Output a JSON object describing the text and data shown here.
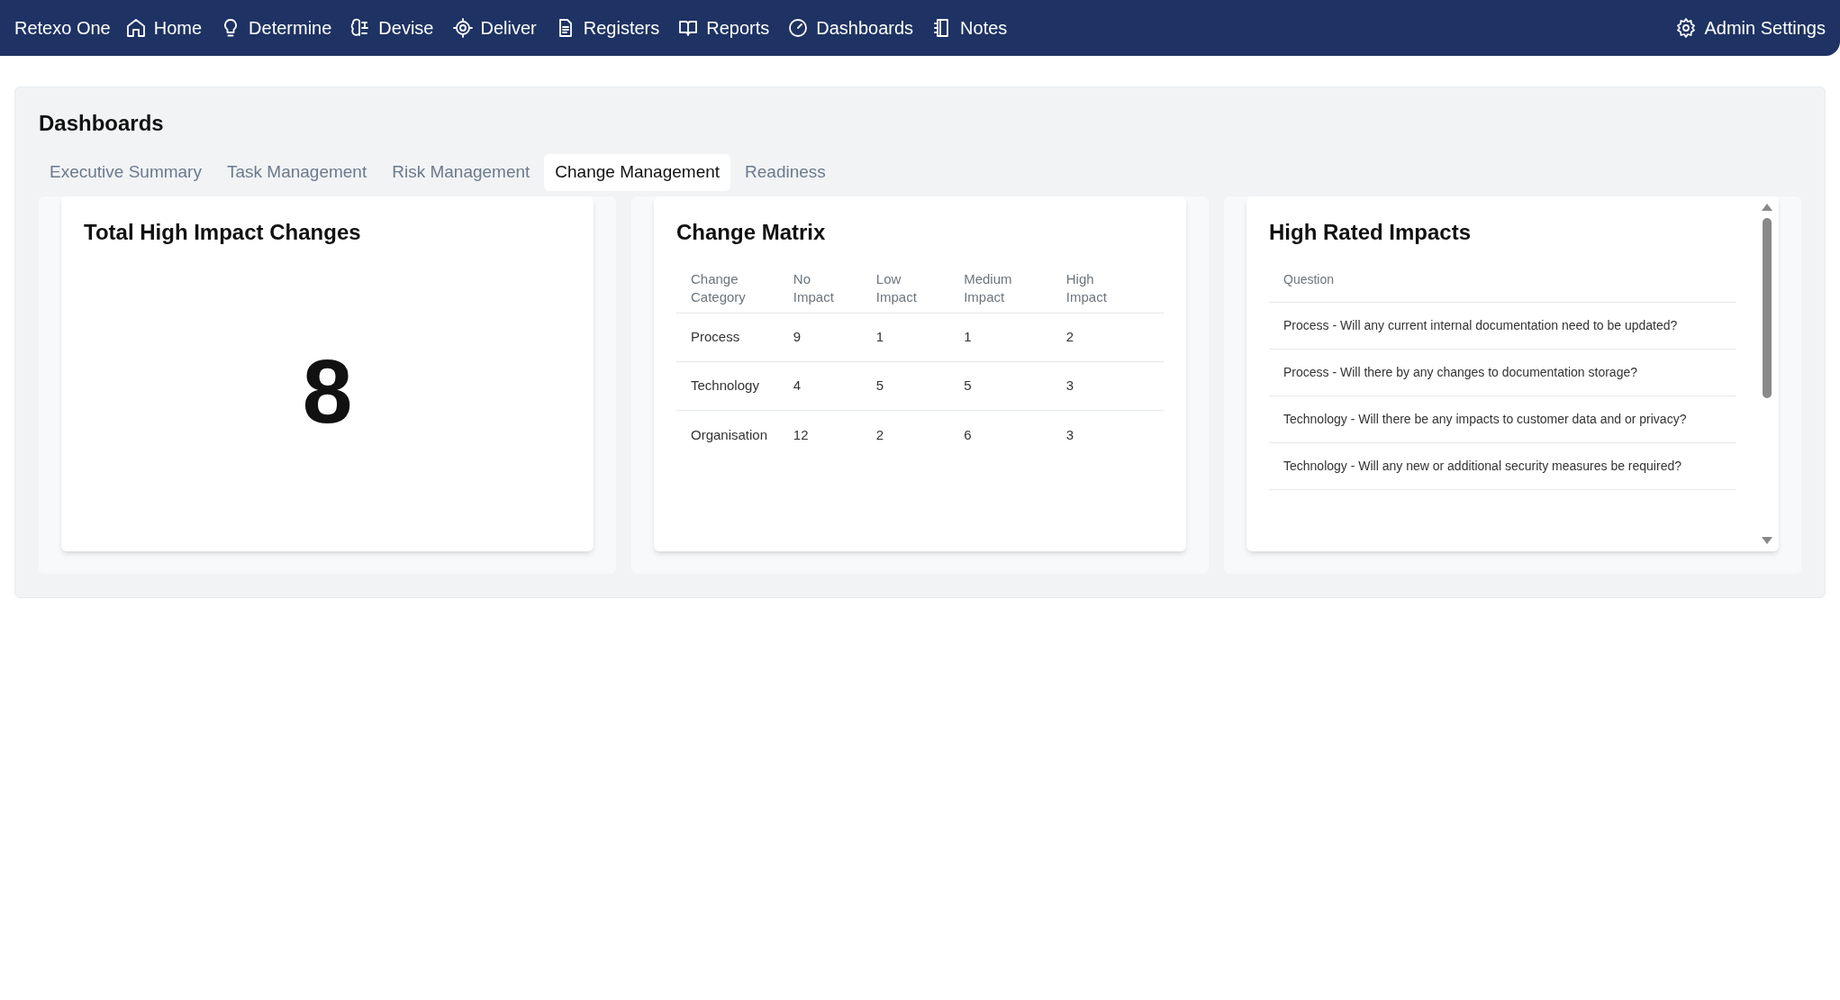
{
  "nav": {
    "brand": "Retexo One",
    "items": [
      {
        "label": "Home"
      },
      {
        "label": "Determine"
      },
      {
        "label": "Devise"
      },
      {
        "label": "Deliver"
      },
      {
        "label": "Registers"
      },
      {
        "label": "Reports"
      },
      {
        "label": "Dashboards"
      },
      {
        "label": "Notes"
      }
    ],
    "settings": "Admin Settings"
  },
  "page": {
    "title": "Dashboards",
    "tabs": [
      {
        "label": "Executive Summary",
        "selected": false
      },
      {
        "label": "Task Management",
        "selected": false
      },
      {
        "label": "Risk Management",
        "selected": false
      },
      {
        "label": "Change Management",
        "selected": true
      },
      {
        "label": "Readiness",
        "selected": false
      }
    ]
  },
  "total_card": {
    "title": "Total High Impact Changes",
    "value": "8"
  },
  "matrix_card": {
    "title": "Change Matrix",
    "columns": [
      "Change Category",
      "No Impact",
      "Low Impact",
      "Medium Impact",
      "High Impact"
    ],
    "rows": [
      [
        "Process",
        "9",
        "1",
        "1",
        "2"
      ],
      [
        "Technology",
        "4",
        "5",
        "5",
        "3"
      ],
      [
        "Organisation",
        "12",
        "2",
        "6",
        "3"
      ]
    ]
  },
  "impacts_card": {
    "title": "High Rated Impacts",
    "column": "Question",
    "rows": [
      "Process - Will any current internal documentation need to be updated?",
      "Process - Will there by any changes to documentation storage?",
      "Technology - Will there be any impacts to customer data and or privacy?",
      "Technology - Will any new or additional security measures be required?"
    ]
  }
}
